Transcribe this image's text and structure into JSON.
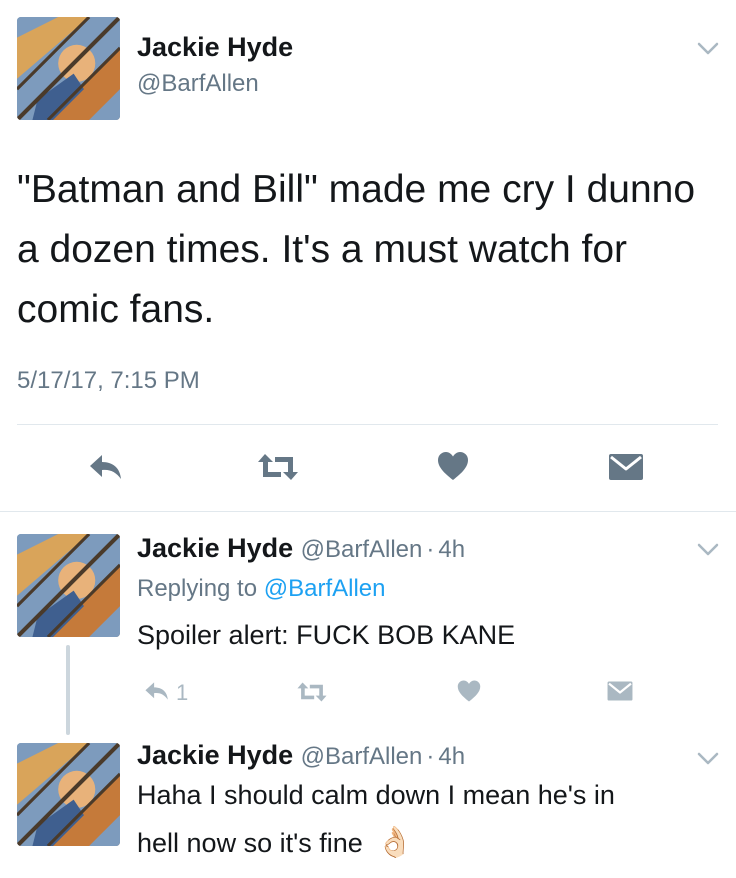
{
  "main_tweet": {
    "display_name": "Jackie Hyde",
    "handle": "@BarfAllen",
    "text_lines": [
      "\"Batman and Bill\" made me cry I dunno",
      "a dozen times. It's a must watch for",
      "comic fans."
    ],
    "timestamp": "5/17/17, 7:15 PM",
    "actions": [
      "reply-icon",
      "retweet-icon",
      "like-icon",
      "direct-message-icon"
    ]
  },
  "replies": [
    {
      "display_name": "Jackie Hyde",
      "handle": "@BarfAllen",
      "separator": "·",
      "age": "4h",
      "replying_prefix": "Replying to",
      "replying_to": "@BarfAllen",
      "text": "Spoiler alert: FUCK BOB KANE",
      "reply_count": "1"
    },
    {
      "display_name": "Jackie Hyde",
      "handle": "@BarfAllen",
      "separator": "·",
      "age": "4h",
      "text_lines": [
        "Haha I should calm down I mean he's in",
        "hell now so it's fine"
      ],
      "emoji": "👌🏻"
    }
  ],
  "colors": {
    "text": "#14171a",
    "secondary": "#657786",
    "accent": "#1da1f2",
    "icon": "#657786",
    "divider": "#e1e8ed"
  }
}
